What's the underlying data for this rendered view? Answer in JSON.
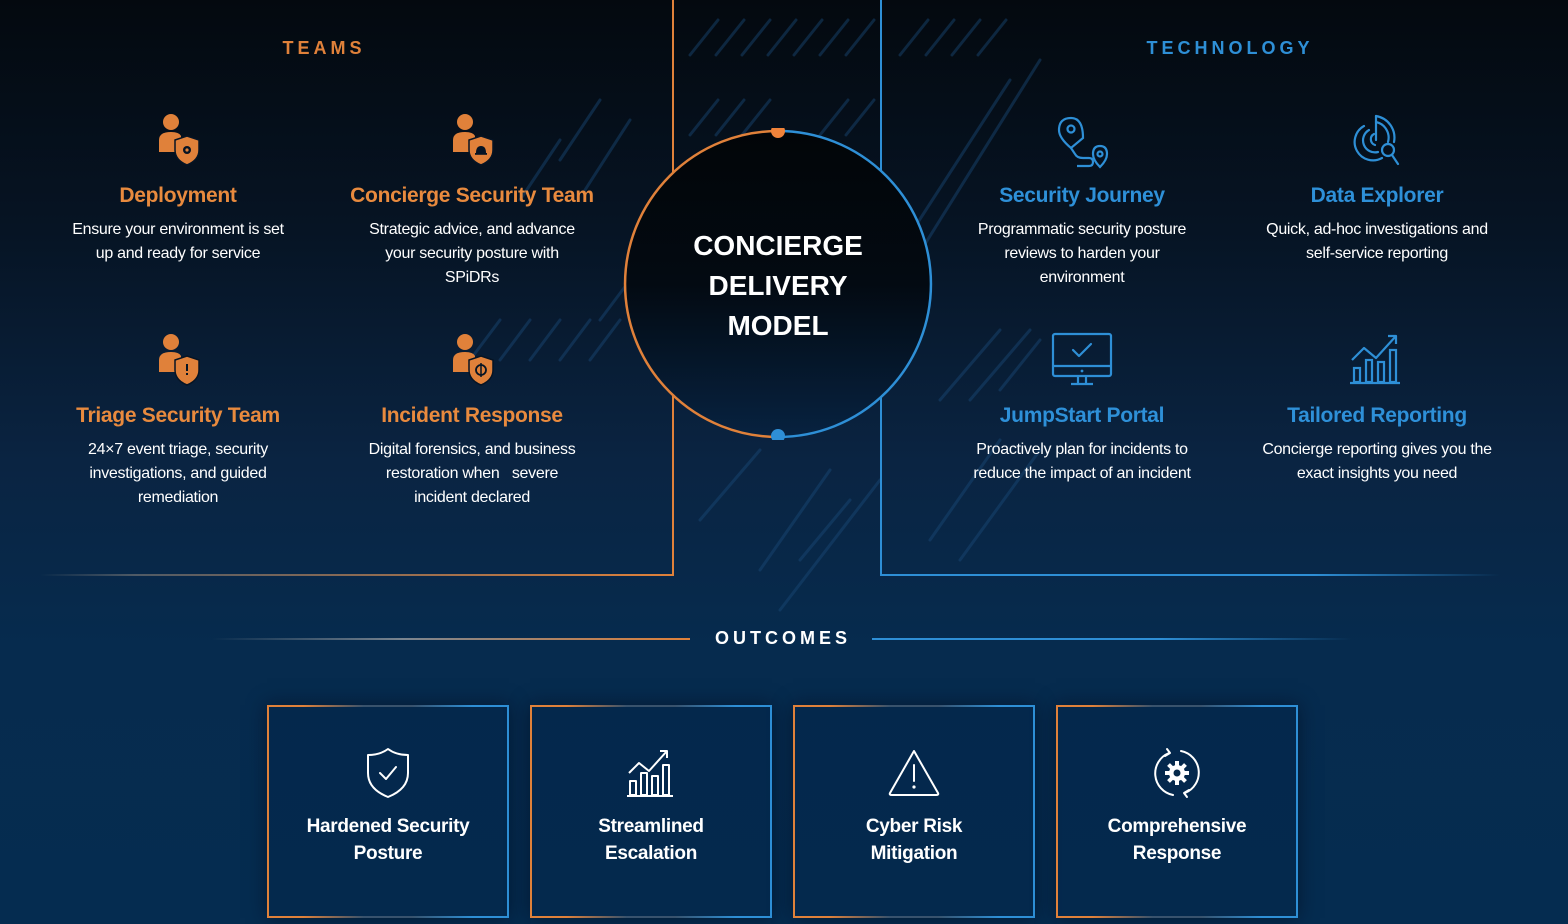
{
  "colors": {
    "teams_accent": "#e0813a",
    "technology_accent": "#2e8fd6",
    "text": "#ffffff",
    "background_top": "#04090f",
    "background_bottom": "#052c50"
  },
  "teams": {
    "title": "TEAMS",
    "items": [
      {
        "icon": "user-shield-gear-icon",
        "name": "Deployment",
        "desc_lines": [
          "Ensure your environment is set",
          "up and ready for service"
        ]
      },
      {
        "icon": "user-shield-bell-icon",
        "name": "Concierge Security Team",
        "desc_lines": [
          "Strategic advice, and advance",
          "your security posture with",
          "SPiDRs"
        ]
      },
      {
        "icon": "user-shield-alert-icon",
        "name": "Triage Security Team",
        "desc_lines": [
          "24×7 event triage, security",
          "investigations, and guided",
          "remediation"
        ]
      },
      {
        "icon": "user-shield-target-icon",
        "name": "Incident Response",
        "desc_lines": [
          "Digital forensics, and business",
          "restoration when   severe",
          "incident declared"
        ]
      }
    ]
  },
  "center": {
    "lines": [
      "CONCIERGE",
      "DELIVERY",
      "MODEL"
    ]
  },
  "technology": {
    "title": "TECHNOLOGY",
    "items": [
      {
        "icon": "route-pins-icon",
        "name": "Security Journey",
        "desc_lines": [
          "Programmatic security posture",
          "reviews to harden your",
          "environment"
        ]
      },
      {
        "icon": "radar-search-icon",
        "name": "Data Explorer",
        "desc_lines": [
          "Quick, ad-hoc investigations and",
          "self-service reporting"
        ]
      },
      {
        "icon": "monitor-check-icon",
        "name": "JumpStart Portal",
        "desc_lines": [
          "Proactively plan for incidents to",
          "reduce the impact of an incident"
        ]
      },
      {
        "icon": "bar-chart-trend-icon",
        "name": "Tailored Reporting",
        "desc_lines": [
          "Concierge reporting gives you the",
          "exact insights you need"
        ]
      }
    ]
  },
  "outcomes": {
    "title": "OUTCOMES",
    "cards": [
      {
        "icon": "shield-check-icon",
        "label_lines": [
          "Hardened Security",
          "Posture"
        ]
      },
      {
        "icon": "bar-chart-trend-icon",
        "label_lines": [
          "Streamlined",
          "Escalation"
        ]
      },
      {
        "icon": "warning-triangle-icon",
        "label_lines": [
          "Cyber Risk",
          "Mitigation"
        ]
      },
      {
        "icon": "gear-cycle-icon",
        "label_lines": [
          "Comprehensive",
          "Response"
        ]
      }
    ]
  }
}
